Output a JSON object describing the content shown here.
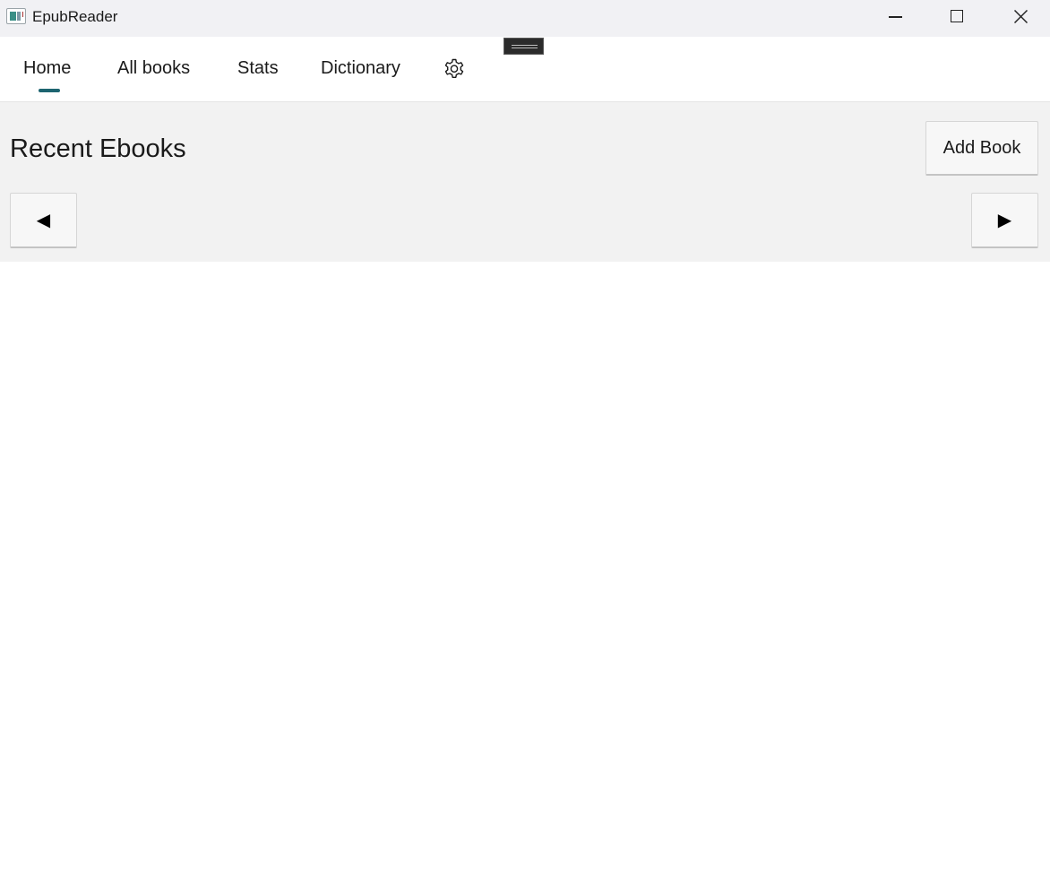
{
  "window": {
    "title": "EpubReader",
    "controls": {
      "minimize_icon": "minimize-icon",
      "maximize_icon": "maximize-icon",
      "close_icon": "close-icon"
    }
  },
  "nav": {
    "items": [
      {
        "label": "Home",
        "selected": true
      },
      {
        "label": "All books",
        "selected": false
      },
      {
        "label": "Stats",
        "selected": false
      },
      {
        "label": "Dictionary",
        "selected": false
      }
    ],
    "settings_icon": "gear-icon",
    "accent_color": "#1d6470"
  },
  "recent": {
    "title": "Recent Ebooks",
    "add_button_label": "Add Book",
    "prev_glyph": "◀",
    "next_glyph": "▶"
  }
}
